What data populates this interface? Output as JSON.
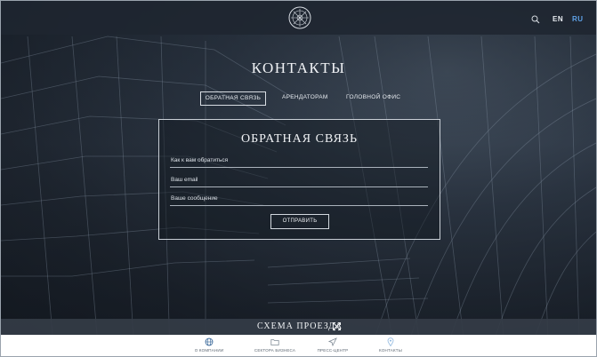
{
  "header": {
    "lang_en": "EN",
    "lang_ru": "RU",
    "active_lang_color": "#5ea2e8"
  },
  "page": {
    "title": "КОНТАКТЫ",
    "tabs": [
      "ОБРАТНАЯ СВЯЗЬ",
      "АРЕНДАТОРАМ",
      "ГОЛОВНОЙ ОФИС"
    ],
    "active_tab": "ОБРАТНАЯ СВЯЗЬ"
  },
  "form": {
    "title": "ОБРАТНАЯ СВЯЗЬ",
    "name_placeholder": "Как к вам обратиться",
    "email_placeholder": "Ваш email",
    "message_placeholder": "Ваше сообщение",
    "submit_label": "ОТПРАВИТЬ"
  },
  "map": {
    "label": "СХЕМА ПРОЕЗДА"
  },
  "bottom_nav": {
    "items": [
      {
        "label": "О КОМПАНИИ",
        "icon": "globe-icon"
      },
      {
        "label": "СЕКТОРА БИЗНЕСА",
        "icon": "folder-icon"
      },
      {
        "label": "ПРЕСС-ЦЕНТР",
        "icon": "send-icon"
      },
      {
        "label": "КОНТАКТЫ",
        "icon": "location-pin-icon"
      }
    ]
  }
}
